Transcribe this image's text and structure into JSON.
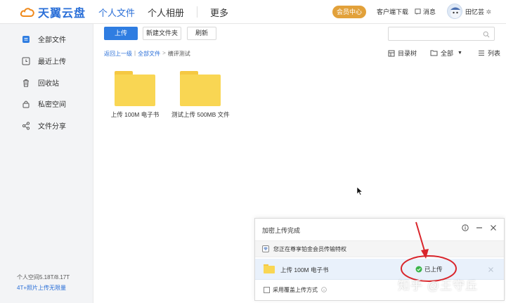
{
  "header": {
    "logo_text": "天翼云盘",
    "nav": [
      "个人文件",
      "个人相册",
      "更多"
    ],
    "vip_label": "会员中心",
    "client_download": "客户端下载",
    "messages": "消息",
    "user_name": "田忆芸"
  },
  "sidebar": {
    "items": [
      {
        "label": "全部文件",
        "icon": "all-files-icon"
      },
      {
        "label": "最近上传",
        "icon": "recent-upload-icon"
      },
      {
        "label": "回收站",
        "icon": "trash-icon"
      },
      {
        "label": "私密空间",
        "icon": "private-space-icon"
      },
      {
        "label": "文件分享",
        "icon": "share-icon"
      }
    ],
    "storage": "个人空间5.18T/8.17T",
    "storage_link": "4T+照片上传无限量"
  },
  "toolbar": {
    "upload": "上传",
    "new_folder": "新建文件夹",
    "refresh": "刷新",
    "search_placeholder": ""
  },
  "breadcrumb": {
    "back": "返回上一级",
    "all_files": "全部文件",
    "current": "横评测试"
  },
  "view": {
    "tree": "目录树",
    "filter": "全部",
    "list": "列表"
  },
  "files": [
    {
      "name": "上传 100M 电子书"
    },
    {
      "name": "测试上传 500MB 文件"
    }
  ],
  "upload_panel": {
    "title": "加密上传完成",
    "vip_notice": "您正在尊享铂金会员传输特权",
    "item_name": "上传 100M 电子书",
    "item_status": "已上传",
    "overwrite_option": "采用覆盖上传方式"
  },
  "watermark": "知乎 @王守丘",
  "colors": {
    "accent": "#2f7de1",
    "folder": "#f9d653",
    "vip": "#e2a13a",
    "success": "#3bb54a",
    "annotation": "#d9252b"
  }
}
